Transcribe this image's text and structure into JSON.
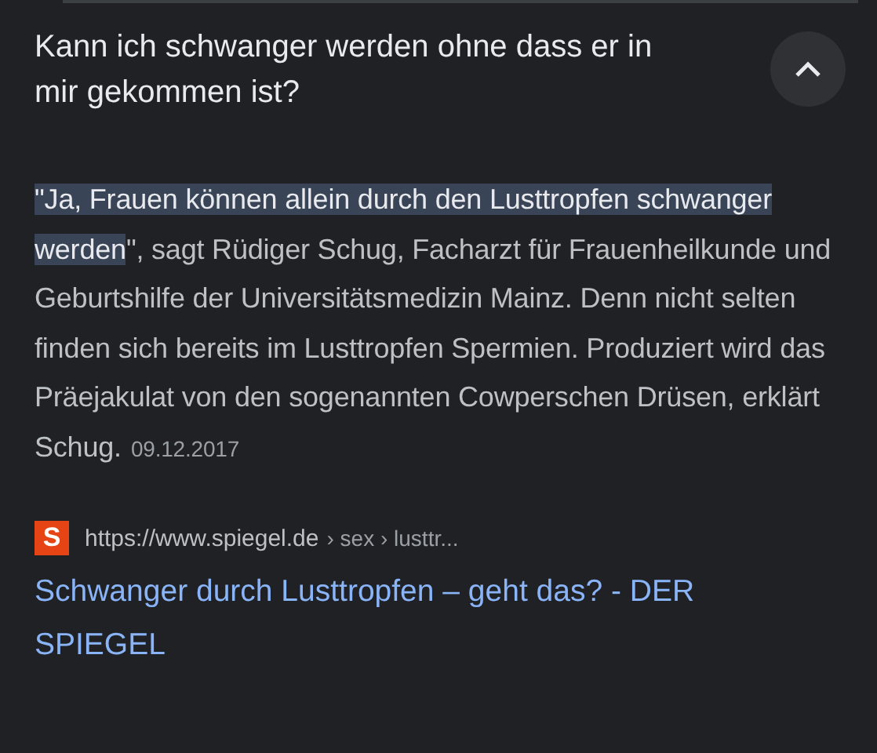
{
  "question": {
    "text": "Kann ich schwanger werden ohne dass er in mir gekommen ist?",
    "expanded": true
  },
  "answer": {
    "highlight": "\"Ja, Frauen können allein durch den Lusttropfen schwanger werden",
    "text": "\", sagt Rüdiger Schug, Facharzt für Frauenheilkunde und Geburtshilfe der Universitätsmedizin Mainz. Denn nicht selten finden sich bereits im Lusttropfen Spermien. Produziert wird das Präejakulat von den sogenannten Cowperschen Drüsen, erklärt Schug.",
    "date": "09.12.2017"
  },
  "source": {
    "favicon": "S",
    "url": "https://www.spiegel.de",
    "path": "› sex › lusttr...",
    "title": "Schwanger durch Lusttropfen – geht das? - DER SPIEGEL"
  }
}
